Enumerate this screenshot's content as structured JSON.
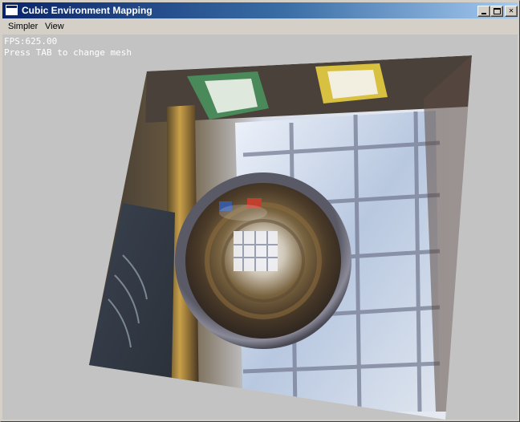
{
  "window": {
    "title": "Cubic Environment Mapping",
    "controls": {
      "minimize": "_",
      "maximize": "□",
      "close": "✕"
    }
  },
  "menu": {
    "items": [
      "Simpler",
      "View"
    ]
  },
  "hud": {
    "fps": "FPS:625.00",
    "hint": "Press TAB to change mesh"
  },
  "scene": {
    "background_color": "#c3c3c3",
    "skybox_quad": {
      "description_icon": "office-room-environment-texture"
    },
    "mesh": "reflective-sphere"
  }
}
